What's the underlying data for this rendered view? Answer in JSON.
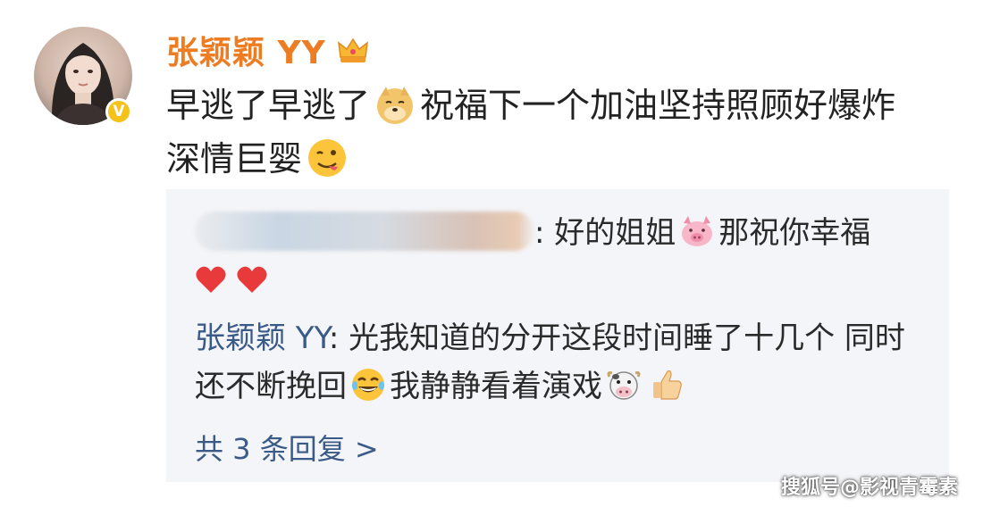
{
  "comment": {
    "author": "张颖颖 YY",
    "text_part1": "早逃了早逃了",
    "text_part2": "祝福下一个加油坚持照顾好爆炸",
    "text_part3": "深情巨婴"
  },
  "replies": [
    {
      "author_redacted": true,
      "text_part1": ": 好的姐姐",
      "text_part2": "那祝你幸福"
    },
    {
      "author": "张颖颖 YY",
      "text_part1": ": 光我知道的分开这段时间睡了十几个 同时还不断挽回",
      "text_part2": "我静静看着演戏"
    }
  ],
  "more_replies_label": "共 3 条回复 >",
  "watermark": "搜狐号@影视青霉素",
  "icons": {
    "crown": "crown-icon",
    "doge": "doge-emoji-icon",
    "tongue": "tongue-face-emoji-icon",
    "pig": "pig-emoji-icon",
    "heart": "heart-emoji-icon",
    "laugh": "laugh-cry-emoji-icon",
    "cow": "cow-emoji-icon",
    "thumbs": "thumbs-up-emoji-icon"
  },
  "colors": {
    "author_name": "#ee7c22",
    "reply_author": "#3a5a87",
    "reply_bg": "#f4f5f8",
    "verified": "#f4c21b"
  }
}
